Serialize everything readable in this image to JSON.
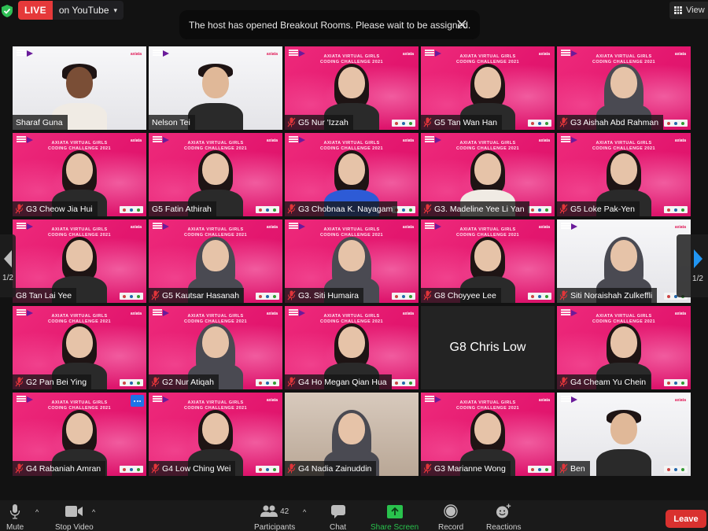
{
  "top_bar": {
    "live_badge": "LIVE",
    "live_target": "on YouTube",
    "live_caret": "▾",
    "view_label": "View",
    "security_color": "#2fbf55"
  },
  "notification": {
    "text": "The host has opened Breakout Rooms. Please wait to be assigned."
  },
  "pagination": {
    "left_label": "1/2",
    "right_label": "1/2"
  },
  "participants": [
    {
      "name": "Sharaf Guna",
      "muted": false,
      "bg": "white",
      "active": true
    },
    {
      "name": "Nelson Tei",
      "muted": false,
      "bg": "white"
    },
    {
      "name": "G5 Nur 'Izzah",
      "muted": true,
      "bg": "pink"
    },
    {
      "name": "G5 Tan Wan Han",
      "muted": true,
      "bg": "pink"
    },
    {
      "name": "G3 Aishah Abd Rahman",
      "muted": true,
      "bg": "pink"
    },
    {
      "name": "G3 Cheow Jia Hui",
      "muted": true,
      "bg": "pink"
    },
    {
      "name": "G5 Fatin Athirah",
      "muted": false,
      "bg": "pink"
    },
    {
      "name": "G3 Chobnaa K. Nayagam",
      "muted": true,
      "bg": "pink"
    },
    {
      "name": "G3. Madeline Yee Li Yan",
      "muted": true,
      "bg": "pink"
    },
    {
      "name": "G5 Loke Pak-Yen",
      "muted": true,
      "bg": "pink"
    },
    {
      "name": "G8 Tan Lai Yee",
      "muted": false,
      "bg": "pink"
    },
    {
      "name": "G5 Kautsar Hasanah",
      "muted": true,
      "bg": "pink"
    },
    {
      "name": "G3. Siti Humaira",
      "muted": true,
      "bg": "pink"
    },
    {
      "name": "G8 Choyyee Lee",
      "muted": true,
      "bg": "pink"
    },
    {
      "name": "Siti Noraishah Zulkeffli",
      "muted": true,
      "bg": "white"
    },
    {
      "name": "G2 Pan Bei Ying",
      "muted": true,
      "bg": "pink"
    },
    {
      "name": "G2 Nur Atiqah",
      "muted": true,
      "bg": "pink"
    },
    {
      "name": "G4 Ho Megan Qian Hua",
      "muted": true,
      "bg": "pink"
    },
    {
      "name": "G8 Chris Low",
      "muted": false,
      "bg": "dark",
      "video_off": true
    },
    {
      "name": "G4 Cheam Yu Chein",
      "muted": true,
      "bg": "pink"
    },
    {
      "name": "G4 Rabaniah Amran",
      "muted": true,
      "bg": "pink"
    },
    {
      "name": "G4 Low Ching Wei",
      "muted": true,
      "bg": "pink"
    },
    {
      "name": "G4 Nadia Zainuddin",
      "muted": true,
      "bg": "photo"
    },
    {
      "name": "G3 Marianne Wong",
      "muted": true,
      "bg": "pink"
    },
    {
      "name": "Ben",
      "muted": true,
      "bg": "white"
    }
  ],
  "banner_text": {
    "line1": "AXIATA VIRTUAL GIRLS",
    "line2": "CODING CHALLENGE 2021",
    "brand": "axiata"
  },
  "toolbar": {
    "mute": "Mute",
    "stop_video": "Stop Video",
    "participants": "Participants",
    "participants_count": "42",
    "chat": "Chat",
    "share_screen": "Share Screen",
    "record": "Record",
    "reactions": "Reactions",
    "leave": "Leave",
    "caret": "^"
  },
  "colors": {
    "accent_green": "#29c24d",
    "leave_red": "#d9312f",
    "live_red": "#e5393a",
    "active_speaker": "#a7d94a",
    "tile_pink": "#e51e73"
  }
}
